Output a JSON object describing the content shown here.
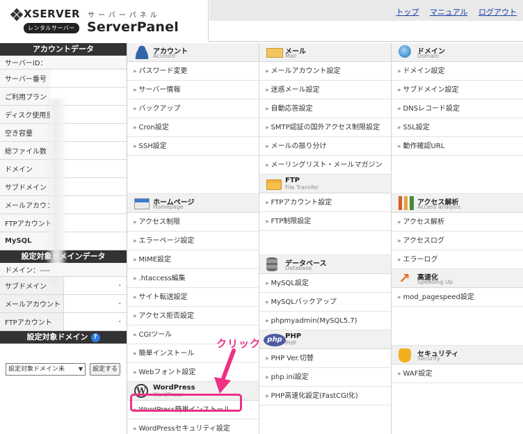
{
  "header": {
    "brand": "XSERVER",
    "badge": "レンタルサーバー",
    "kana": "サーバーパネル",
    "title": "ServerPanel",
    "links": [
      "トップ",
      "マニュアル",
      "ログアウト"
    ]
  },
  "sidebar": {
    "account_title": "アカウントデータ",
    "account_rows": [
      "サーバーID：",
      "サーバー番号",
      "ご利用プラン",
      "ディスク使用量",
      "空き容量",
      "総ファイル数",
      "ドメイン",
      "サブドメイン",
      "メールアカウント",
      "FTPアカウント",
      "MySQL"
    ],
    "domain_title": "設定対象ドメインデータ",
    "domain_label": "ドメイン：----",
    "domain_rows": [
      {
        "label": "サブドメイン",
        "value": "-"
      },
      {
        "label": "メールアカウント",
        "value": "-"
      },
      {
        "label": "FTPアカウント",
        "value": "-"
      }
    ],
    "select_title": "設定対象ドメイン",
    "select_value": "設定対象ドメイン未",
    "set_button": "設定する"
  },
  "columns": {
    "account": {
      "title": "アカウント",
      "sub": "Account",
      "items": [
        "パスワード変更",
        "サーバー情報",
        "バックアップ",
        "Cron設定",
        "SSH設定"
      ]
    },
    "home": {
      "title": "ホームページ",
      "sub": "Homepage",
      "items": [
        "アクセス制限",
        "エラーページ設定",
        "MIME設定",
        ".htaccess編集",
        "サイト転送設定",
        "アクセス拒否設定",
        "CGIツール",
        "簡単インストール",
        "Webフォント設定"
      ]
    },
    "wordpress": {
      "title": "WordPress",
      "sub": "WordPress",
      "items": [
        "WordPress簡単インストール",
        "WordPressセキュリティ設定"
      ]
    },
    "mail": {
      "title": "メール",
      "sub": "Mail",
      "items": [
        "メールアカウント設定",
        "迷惑メール設定",
        "自動応答設定",
        "SMTP認証の国外アクセス制限設定",
        "メールの振り分け",
        "メーリングリスト・メールマガジン"
      ]
    },
    "ftp": {
      "title": "FTP",
      "sub": "File Transfer",
      "items": [
        "FTPアカウント設定",
        "FTP制限設定"
      ]
    },
    "database": {
      "title": "データベース",
      "sub": "Database",
      "items": [
        "MySQL設定",
        "MySQLバックアップ",
        "phpmyadmin(MySQL5.7)"
      ]
    },
    "php": {
      "title": "PHP",
      "sub": "PHP",
      "items": [
        "PHP Ver.切替",
        "php.ini設定",
        "PHP高速化設定(FastCGI化)"
      ]
    },
    "domain": {
      "title": "ドメイン",
      "sub": "Domain",
      "items": [
        "ドメイン設定",
        "サブドメイン設定",
        "DNSレコード設定",
        "SSL設定",
        "動作確認URL"
      ]
    },
    "access": {
      "title": "アクセス解析",
      "sub": "Access analysis",
      "items": [
        "アクセス解析",
        "アクセスログ",
        "エラーログ"
      ]
    },
    "speed": {
      "title": "高速化",
      "sub": "Speeding Up",
      "items": [
        "mod_pagespeed設定"
      ]
    },
    "security": {
      "title": "セキュリティ",
      "sub": "Security",
      "items": [
        "WAF設定"
      ]
    }
  },
  "annotation": {
    "text": "クリック",
    "color": "#ee2f86"
  },
  "colors": {
    "link": "#1a3ea8",
    "section_bg": "#f1f1f1",
    "sidebar_head": "#333333"
  }
}
